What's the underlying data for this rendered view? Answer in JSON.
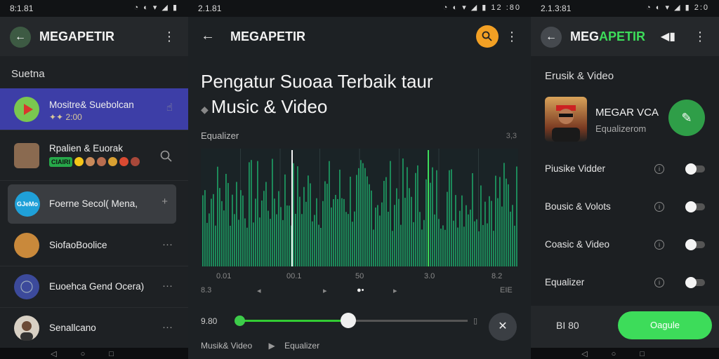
{
  "colors": {
    "accent_green": "#3ddc5a",
    "active_row": "#3d3ea7",
    "orange": "#f2a024",
    "wave": "#1fa86a"
  },
  "panel1": {
    "status": {
      "time": "8:1.81"
    },
    "app_title": "MEGAPETIR",
    "section": "Suetna",
    "rows": [
      {
        "name": "Mositre& Suebolcan",
        "sub": "✦✦ 2:00",
        "avatar_color": "#7ac74f",
        "trail_icon": "gesture-icon"
      },
      {
        "name": "Rpalien & Euorak",
        "badge": "CIAIRI",
        "avatar_color": "#8a6a50",
        "trail_icon": "search-icon"
      },
      {
        "name": "Foerne Secol( Mena,",
        "avatar_color": "#1fa0d8",
        "avatar_text": "GJeMo",
        "trail_icon": "plus-icon"
      },
      {
        "name": "SiofaoBoolice",
        "avatar_color": "#c9893b",
        "trail_icon": "more-icon"
      },
      {
        "name": "Euoehca Gend Ocera)",
        "avatar_color": "#3c4a9b",
        "trail_icon": "more-icon"
      },
      {
        "name": "Senallcano",
        "avatar_color": "#d8d0c4",
        "trail_icon": "more-icon"
      }
    ]
  },
  "panel2": {
    "status": {
      "time": "2.1.81",
      "extra": "12 :80"
    },
    "app_title": "MEGAPETIR",
    "headline_line1": "Pengatur Suoaa Terbaik taur",
    "headline_line2": "Music & Video",
    "eq_label": "Equalizer",
    "eq_right": "3,3",
    "axis": [
      "0.01",
      "00.1",
      "50",
      "3.0",
      "8.2"
    ],
    "axis2_left": "8.3",
    "axis2_right": "EIE",
    "volume_label": "9.80",
    "volume": 0.48,
    "tab_music": "Musik& Video",
    "tab_eq": "Equalizer"
  },
  "panel3": {
    "status": {
      "time": "2.1.3:81",
      "extra": "2:0"
    },
    "app_title_white": "MEG",
    "app_title_green": "APETIR",
    "section": "Erusik & Video",
    "card_name": "MEGAR VCA",
    "card_sub": "Equalizerom",
    "options": [
      {
        "label": "Piusike Vidder",
        "on": false
      },
      {
        "label": "Bousic & Volots",
        "on": false
      },
      {
        "label": "Coasic & Video",
        "on": false
      },
      {
        "label": "Equalizer",
        "on": false
      }
    ],
    "footer_left": "BI 80",
    "footer_button": "Oagule"
  }
}
